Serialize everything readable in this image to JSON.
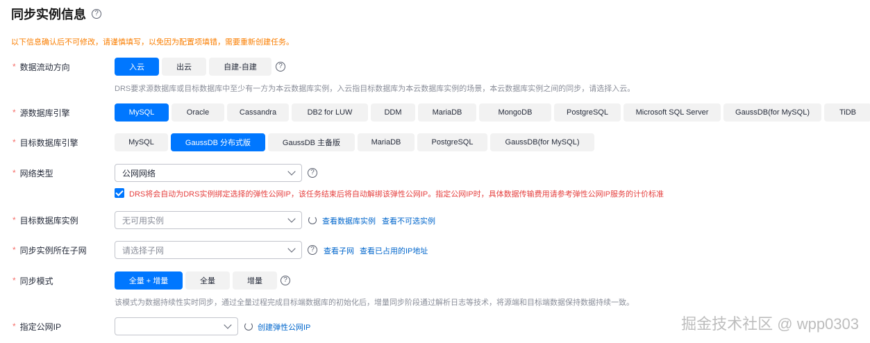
{
  "title": "同步实例信息",
  "notice": "以下信息确认后不可修改，请谨慎填写，以免因为配置项填错，需要重新创建任务。",
  "flow": {
    "label": "数据流动方向",
    "options": [
      "入云",
      "出云",
      "自建-自建"
    ],
    "selected": "入云",
    "desc": "DRS要求源数据库或目标数据库中至少有一方为本云数据库实例，入云指目标数据库为本云数据库实例的场景，本云数据库实例之间的同步，请选择入云。"
  },
  "source_engine": {
    "label": "源数据库引擎",
    "options": [
      "MySQL",
      "Oracle",
      "Cassandra",
      "DB2 for LUW",
      "DDM",
      "MariaDB",
      "MongoDB",
      "PostgreSQL",
      "Microsoft SQL Server",
      "GaussDB(for MySQL)",
      "TiDB"
    ],
    "selected": "MySQL"
  },
  "target_engine": {
    "label": "目标数据库引擎",
    "options": [
      "MySQL",
      "GaussDB 分布式版",
      "GaussDB 主备版",
      "MariaDB",
      "PostgreSQL",
      "GaussDB(for MySQL)"
    ],
    "selected": "GaussDB 分布式版"
  },
  "network": {
    "label": "网络类型",
    "value": "公网网络",
    "checkbox_text": "DRS将会自动为DRS实例绑定选择的弹性公网IP，该任务结束后将自动解绑该弹性公网IP。指定公网IP时，具体数据传输费用请参考弹性公网IP服务的计价标准"
  },
  "target_instance": {
    "label": "目标数据库实例",
    "placeholder": "无可用实例",
    "links": [
      "查看数据库实例",
      "查看不可选实例"
    ]
  },
  "subnet": {
    "label": "同步实例所在子网",
    "placeholder": "请选择子网",
    "links": [
      "查看子网",
      "查看已占用的IP地址"
    ]
  },
  "sync_mode": {
    "label": "同步模式",
    "options": [
      "全量 + 增量",
      "全量",
      "增量"
    ],
    "selected": "全量 + 增量",
    "desc": "该模式为数据持续性实时同步，通过全量过程完成目标端数据库的初始化后，增量同步阶段通过解析日志等技术，将源端和目标端数据保持数据持续一致。"
  },
  "public_ip": {
    "label": "指定公网IP",
    "value": "",
    "link": "创建弹性公网IP"
  },
  "watermark": "掘金技术社区 @ wpp0303",
  "colors": {
    "primary": "#0077ff",
    "notice": "#fa7e00",
    "error": "#e5403f",
    "link": "#0066cc"
  }
}
